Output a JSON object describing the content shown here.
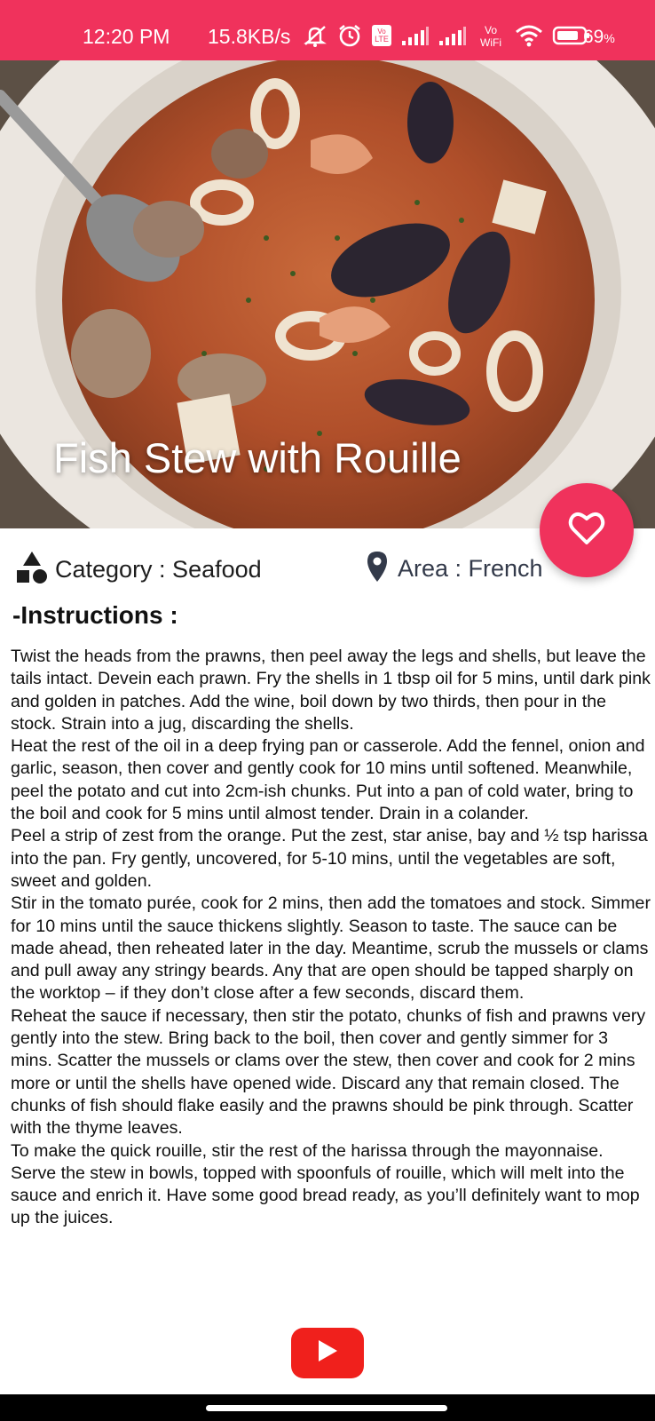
{
  "status_bar": {
    "time": "12:20 PM",
    "network_speed": "15.8KB/s",
    "battery_percent": "69",
    "battery_suffix": "%",
    "icons": [
      "mute-icon",
      "alarm-icon",
      "volte-icon",
      "signal-icon",
      "signal-icon",
      "vowifi-icon",
      "wifi-icon",
      "battery-icon"
    ],
    "vowifi_label": "Vo WiFi",
    "lte_label": "LTE",
    "background_color": "#f0325c"
  },
  "recipe": {
    "title": "Fish Stew with Rouille",
    "category_label": "Category : Seafood",
    "area_label": "Area : French",
    "instructions_heading": "-Instructions :",
    "instructions_text": "Twist the heads from the prawns, then peel away the legs and shells, but leave the tails intact. Devein each prawn. Fry the shells in 1 tbsp oil for 5 mins, until dark pink and golden in patches. Add the wine, boil down by two thirds, then pour in the stock. Strain into a jug, discarding the shells.\nHeat the rest of the oil in a deep frying pan or casserole. Add the fennel, onion and garlic, season, then cover and gently cook for 10 mins until softened. Meanwhile, peel the potato and cut into 2cm-ish chunks. Put into a pan of cold water, bring to the boil and cook for 5 mins until almost tender. Drain in a colander.\nPeel a strip of zest from the orange. Put the zest, star anise, bay and ½ tsp harissa into the pan. Fry gently, uncovered, for 5-10 mins, until the vegetables are soft, sweet and golden.\nStir in the tomato purée, cook for 2 mins, then add the tomatoes and stock. Simmer for 10 mins until the sauce thickens slightly. Season to taste. The sauce can be made ahead, then reheated later in the day. Meantime, scrub the mussels or clams and pull away any stringy beards. Any that are open should be tapped sharply on the worktop – if they don’t close after a few seconds, discard them.\nReheat the sauce if necessary, then stir the potato, chunks of fish and prawns very gently into the stew. Bring back to the boil, then cover and gently simmer for 3 mins. Scatter the mussels or clams over the stew, then cover and cook for 2 mins more or until the shells have opened wide. Discard any that remain closed. The chunks of fish should flake easily and the prawns should be pink through. Scatter with the thyme leaves.\nTo make the quick rouille, stir the rest of the harissa through the mayonnaise. Serve the stew in bowls, topped with spoonfuls of rouille, which will melt into the sauce and enrich it. Have some good bread ready, as you’ll definitely want to mop up the juices."
  },
  "actions": {
    "favorite_icon": "heart-outline-icon",
    "youtube_icon": "youtube-play-icon"
  },
  "colors": {
    "accent": "#f0325c",
    "youtube_red": "#f0201c",
    "area_icon": "#333a4a"
  }
}
